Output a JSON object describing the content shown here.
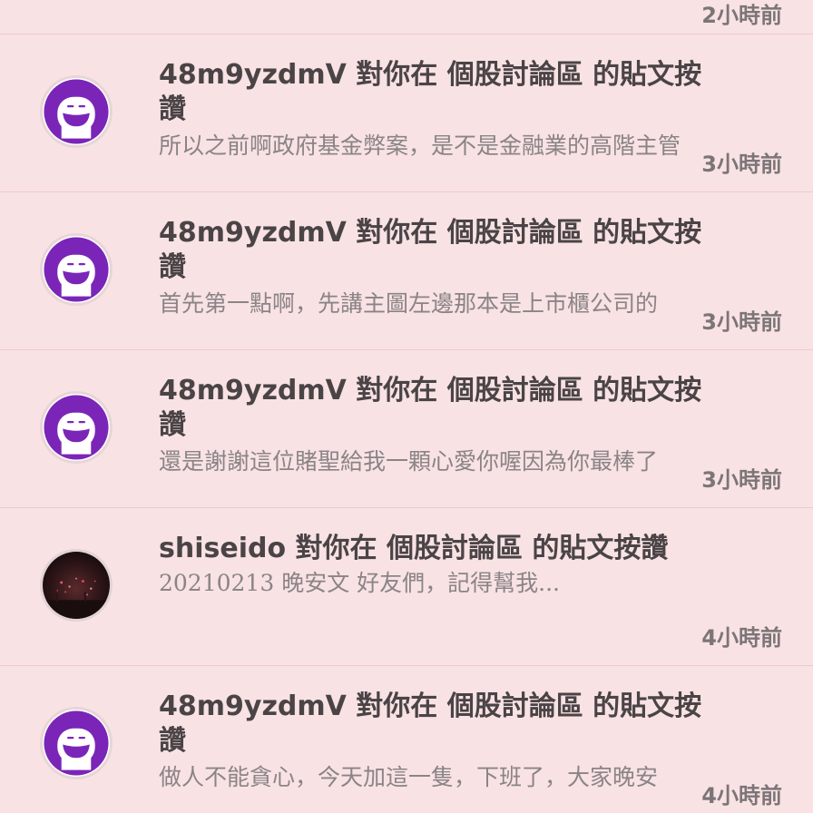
{
  "notifications": [
    {
      "title": "",
      "snippet": "",
      "time": "2小時前",
      "avatar": "none"
    },
    {
      "title": "48m9yzdmV 對你在 個股討論區 的貼文按讚",
      "snippet": "所以之前啊政府基金弊案，是不是金融業的高階主管",
      "time": "3小時前",
      "avatar": "smiley-face-icon"
    },
    {
      "title": "48m9yzdmV 對你在 個股討論區 的貼文按讚",
      "snippet": "首先第一點啊，先講主圖左邊那本是上市櫃公司的",
      "time": "3小時前",
      "avatar": "smiley-face-icon"
    },
    {
      "title": "48m9yzdmV 對你在 個股討論區 的貼文按讚",
      "snippet": "還是謝謝這位賭聖給我一顆心愛你喔因為你最棒了",
      "time": "3小時前",
      "avatar": "smiley-face-icon"
    },
    {
      "title": "shiseido 對你在 個股討論區 的貼文按讚",
      "snippet": "20210213 晚安文 好友們，記得幫我...",
      "time": "4小時前",
      "avatar": "fireworks-photo"
    },
    {
      "title": "48m9yzdmV 對你在 個股討論區 的貼文按讚",
      "snippet": "做人不能貪心，今天加這一隻，下班了，大家晚安",
      "time": "4小時前",
      "avatar": "smiley-face-icon"
    }
  ],
  "colors": {
    "background": "#f9e2e4",
    "divider": "#eec9cd",
    "avatar_purple": "#7b25b8",
    "title_text": "#4a4446",
    "snippet_text": "#8a8486",
    "time_text": "#7c7577"
  }
}
